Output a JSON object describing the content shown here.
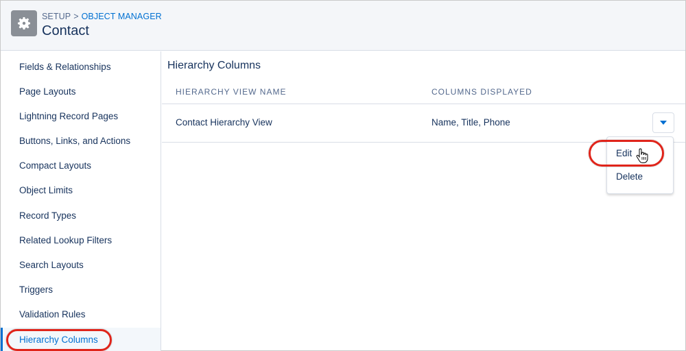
{
  "header": {
    "breadcrumb_root": "SETUP",
    "breadcrumb_sep": ">",
    "breadcrumb_link": "OBJECT MANAGER",
    "title": "Contact",
    "icon": "gear-icon"
  },
  "sidebar": {
    "items": [
      {
        "label": "Fields & Relationships"
      },
      {
        "label": "Page Layouts"
      },
      {
        "label": "Lightning Record Pages"
      },
      {
        "label": "Buttons, Links, and Actions"
      },
      {
        "label": "Compact Layouts"
      },
      {
        "label": "Object Limits"
      },
      {
        "label": "Record Types"
      },
      {
        "label": "Related Lookup Filters"
      },
      {
        "label": "Search Layouts"
      },
      {
        "label": "Triggers"
      },
      {
        "label": "Validation Rules"
      },
      {
        "label": "Hierarchy Columns"
      }
    ],
    "active_item": "Hierarchy Columns"
  },
  "main": {
    "section_title": "Hierarchy Columns",
    "columns": [
      "HIERARCHY VIEW NAME",
      "COLUMNS DISPLAYED"
    ],
    "rows": [
      {
        "name": "Contact Hierarchy View",
        "columns_displayed": "Name, Title, Phone"
      }
    ],
    "row_menu": {
      "icon": "chevron-down-icon",
      "items": [
        "Edit",
        "Delete"
      ]
    }
  },
  "colors": {
    "accent": "#0070d2",
    "highlight": "#e0241a",
    "text": "#16325c",
    "header_bg": "#f4f6f9"
  }
}
